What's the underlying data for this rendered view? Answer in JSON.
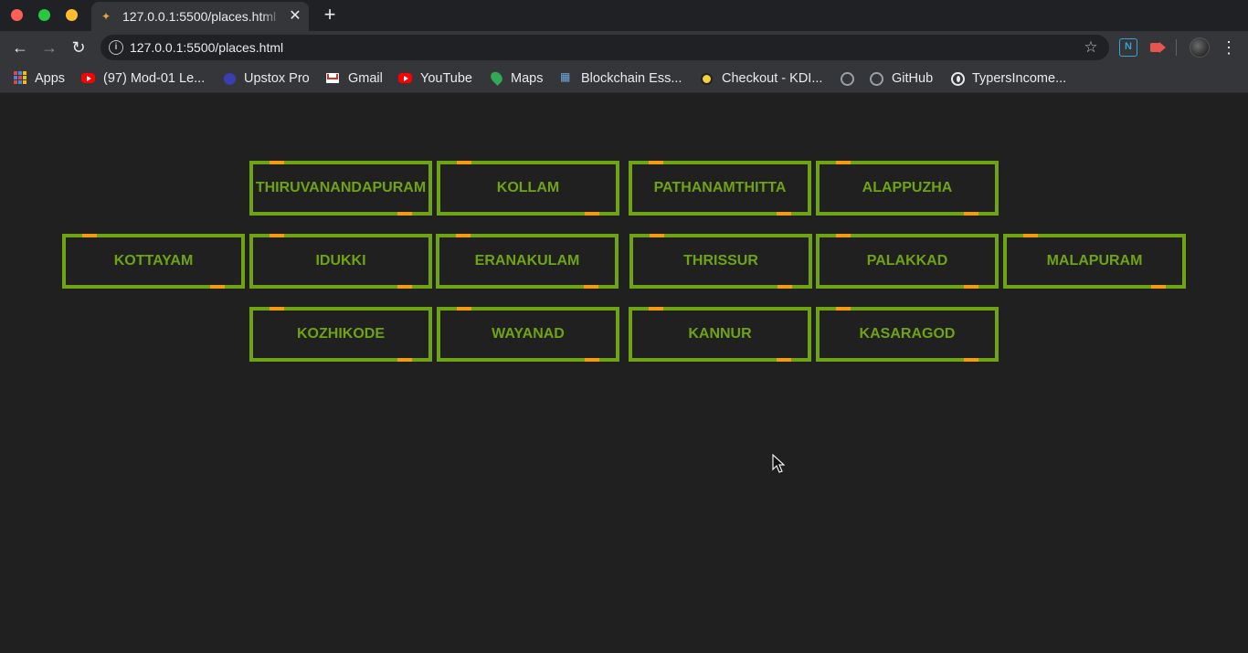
{
  "browser": {
    "tab": {
      "title": "127.0.0.1:5500/places.html",
      "close_glyph": "✕"
    },
    "new_tab_glyph": "+",
    "address_bar": {
      "url": "127.0.0.1:5500/places.html"
    },
    "extensions": {
      "n_label": "N"
    },
    "bookmarks": [
      {
        "label": "Apps",
        "icon": "apps-grid-icon"
      },
      {
        "label": "(97) Mod-01 Le...",
        "icon": "youtube-icon"
      },
      {
        "label": "Upstox Pro",
        "icon": "upstox-icon"
      },
      {
        "label": "Gmail",
        "icon": "gmail-icon"
      },
      {
        "label": "YouTube",
        "icon": "youtube-icon"
      },
      {
        "label": "Maps",
        "icon": "maps-icon"
      },
      {
        "label": "Blockchain Ess...",
        "icon": "blockchain-icon"
      },
      {
        "label": "Checkout - KDI...",
        "icon": "checkout-icon"
      },
      {
        "label": "",
        "icon": "github-icon"
      },
      {
        "label": "GitHub",
        "icon": "github-icon"
      },
      {
        "label": "TypersIncome...",
        "icon": "globe-icon"
      }
    ]
  },
  "places": {
    "row1": [
      "THIRUVANANDAPURAM",
      "KOLLAM",
      "PATHANAMTHITTA",
      "ALAPPUZHA"
    ],
    "row2": [
      "KOTTAYAM",
      "IDUKKI",
      "ERANAKULAM",
      "THRISSUR",
      "PALAKKAD",
      "MALAPURAM"
    ],
    "row3": [
      "KOZHIKODE",
      "WAYANAD",
      "KANNUR",
      "KASARAGOD"
    ]
  },
  "colors": {
    "page_bg": "#202020",
    "button_border": "#6ea414",
    "button_text": "#6ea414",
    "accent_stripe": "#f59b12"
  }
}
